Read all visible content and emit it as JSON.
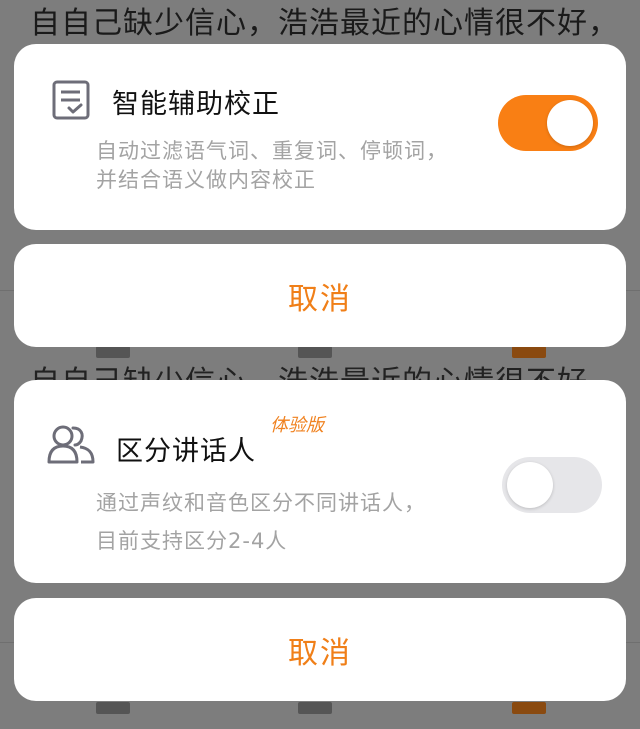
{
  "background": {
    "text_top": "自自己缺少信心，浩浩最近的心情很不好，",
    "text_mid": "自自己缺少信心，浩浩最近的心情很不好，"
  },
  "smart_correction": {
    "icon": "checklist-document-icon",
    "title": "智能辅助校正",
    "description_line1": "自动过滤语气词、重复词、停顿词，",
    "description_line2": "并结合语义做内容校正",
    "enabled": true
  },
  "cancel_top": {
    "label": "取消"
  },
  "speaker_separation": {
    "icon": "people-icon",
    "title": "区分讲话人",
    "badge": "体验版",
    "description_line1": "通过声纹和音色区分不同讲话人，",
    "description_line2": "目前支持区分2-4人",
    "enabled": false
  },
  "cancel_bottom": {
    "label": "取消"
  },
  "colors": {
    "accent": "#f97f14",
    "cancel_text": "#f07f18",
    "toggle_off": "#e6e6e9",
    "overlay": "#7d7d7d"
  }
}
